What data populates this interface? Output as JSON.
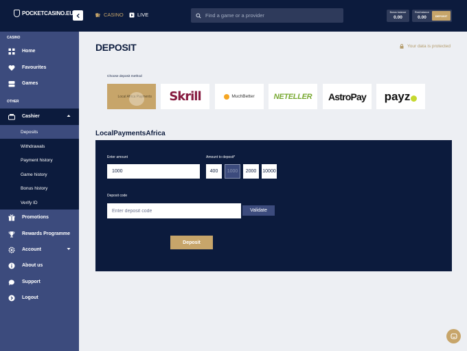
{
  "header": {
    "logo": "POCKETCASINO.EU",
    "nav": [
      {
        "label": "CASINO",
        "icon": "cards-icon"
      },
      {
        "label": "LIVE",
        "icon": "live-icon"
      }
    ],
    "search_placeholder": "Find a game or a provider",
    "bonus_balance": {
      "label": "Bonus balance",
      "value": "0.00"
    },
    "real_balance": {
      "label": "Real balance",
      "value": "0.00"
    },
    "deposit_label": "DEPOSIT"
  },
  "sidebar": {
    "section_casino": "CASINO",
    "section_other": "OTHER",
    "casino_items": [
      {
        "label": "Home",
        "icon": "grid-icon"
      },
      {
        "label": "Favourites",
        "icon": "heart-icon"
      },
      {
        "label": "Games",
        "icon": "games-icon"
      }
    ],
    "cashier": {
      "label": "Cashier",
      "icon": "cashier-icon",
      "sub_items": [
        "Deposits",
        "Withdrawals",
        "Payment history",
        "Game history",
        "Bonus history",
        "Verify ID"
      ]
    },
    "other_items": [
      {
        "label": "Promotions",
        "icon": "gift-icon"
      },
      {
        "label": "Rewards Programme",
        "icon": "trophy-icon"
      },
      {
        "label": "Account",
        "icon": "gear-icon"
      },
      {
        "label": "About us",
        "icon": "info-icon"
      },
      {
        "label": "Support",
        "icon": "support-icon"
      },
      {
        "label": "Logout",
        "icon": "logout-icon"
      }
    ]
  },
  "main": {
    "title": "DEPOSIT",
    "protected_text": "Your data is protected",
    "choose_label": "Choose deposit method",
    "methods": [
      {
        "label": "Local Africa Payments",
        "selected": true
      },
      {
        "label": "Skrill"
      },
      {
        "label": "MuchBetter"
      },
      {
        "label": "NETELLER"
      },
      {
        "label": "AstroPay"
      },
      {
        "label": "payz"
      }
    ],
    "section_title": "LocalPaymentsAfrica",
    "form": {
      "enter_amount_label": "Enter amount",
      "amount_value": "1000",
      "amount_to_deposit_label": "Amount to deposit*",
      "presets": [
        "400",
        "1000",
        "2000",
        "10000"
      ],
      "active_preset": "1000",
      "deposit_code_label": "Deposit code",
      "deposit_code_placeholder": "Enter deposit code",
      "validate_label": "Validate",
      "deposit_button": "Deposit"
    }
  },
  "colors": {
    "navy": "#0c1b3d",
    "sidebar": "#3c4b7d",
    "gold": "#c7a56a",
    "background": "#edeff3"
  }
}
